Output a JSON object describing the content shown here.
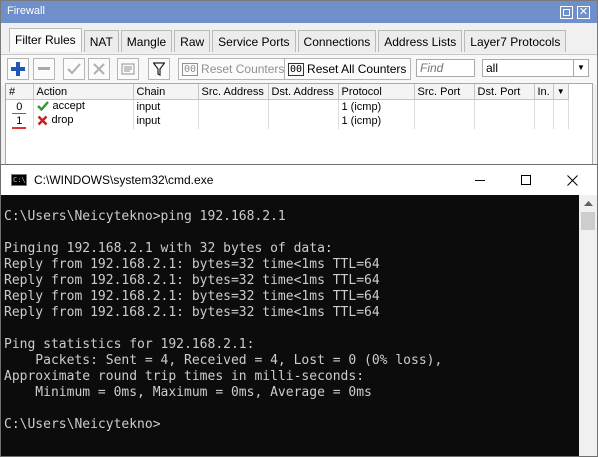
{
  "firewall": {
    "title": "Firewall",
    "tabs": [
      "Filter Rules",
      "NAT",
      "Mangle",
      "Raw",
      "Service Ports",
      "Connections",
      "Address Lists",
      "Layer7 Protocols"
    ],
    "toolbar": {
      "reset_counters": "Reset Counters",
      "reset_all_counters": "Reset All Counters",
      "find_placeholder": "Find",
      "filter_value": "all"
    },
    "columns": [
      "#",
      "Action",
      "Chain",
      "Src. Address",
      "Dst. Address",
      "Protocol",
      "Src. Port",
      "Dst. Port",
      "In."
    ],
    "rows": [
      {
        "num": "0",
        "action": "accept",
        "chain": "input",
        "protocol": "1 (icmp)"
      },
      {
        "num": "1",
        "action": "drop",
        "chain": "input",
        "protocol": "1 (icmp)"
      }
    ],
    "colors": {
      "accept": "#2e9b2e",
      "drop": "#cc1f1f",
      "add": "#1f54b8",
      "title_bar": "#6e8fc9"
    }
  },
  "cmd": {
    "title": "C:\\WINDOWS\\system32\\cmd.exe",
    "icon_text": "C:\\",
    "output": "C:\\Users\\Neicytekno>ping 192.168.2.1\n\nPinging 192.168.2.1 with 32 bytes of data:\nReply from 192.168.2.1: bytes=32 time<1ms TTL=64\nReply from 192.168.2.1: bytes=32 time<1ms TTL=64\nReply from 192.168.2.1: bytes=32 time<1ms TTL=64\nReply from 192.168.2.1: bytes=32 time<1ms TTL=64\n\nPing statistics for 192.168.2.1:\n    Packets: Sent = 4, Received = 4, Lost = 0 (0% loss),\nApproximate round trip times in milli-seconds:\n    Minimum = 0ms, Maximum = 0ms, Average = 0ms\n\nC:\\Users\\Neicytekno>"
  }
}
